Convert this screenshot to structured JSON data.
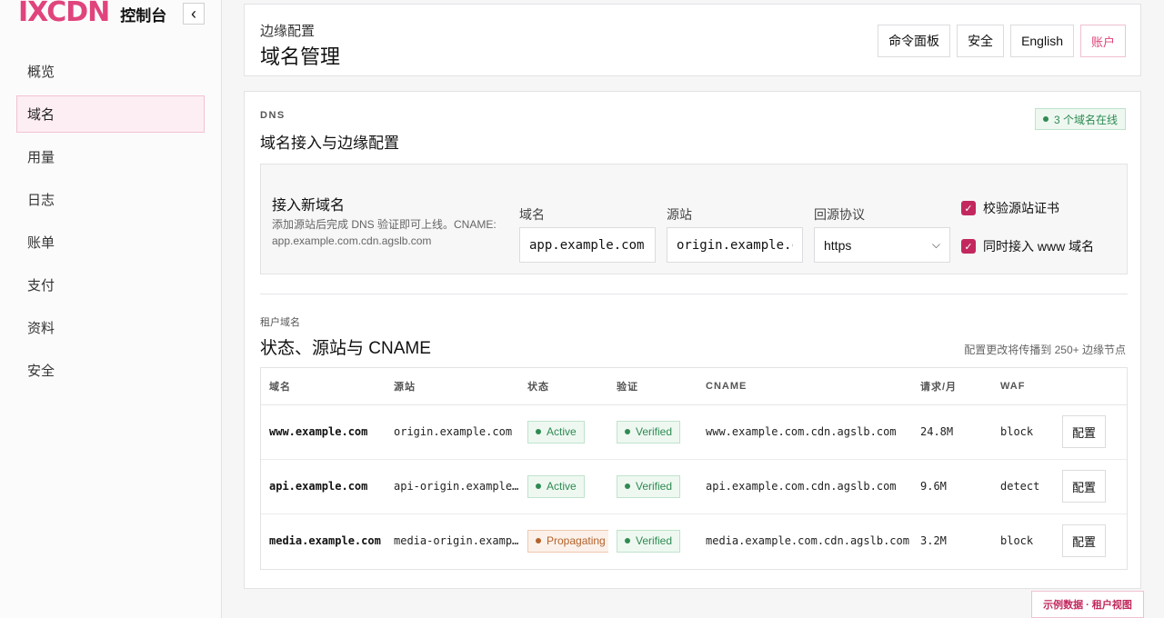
{
  "brand": {
    "logo": "IXCDN",
    "title": "控制台",
    "collapse_icon": "chevron-left-icon"
  },
  "nav": {
    "items": [
      {
        "label": "概览",
        "active": false
      },
      {
        "label": "域名",
        "active": true
      },
      {
        "label": "用量",
        "active": false
      },
      {
        "label": "日志",
        "active": false
      },
      {
        "label": "账单",
        "active": false
      },
      {
        "label": "支付",
        "active": false
      },
      {
        "label": "资料",
        "active": false
      },
      {
        "label": "安全",
        "active": false
      }
    ]
  },
  "header": {
    "eyebrow": "边缘配置",
    "title": "域名管理",
    "actions": {
      "command": "命令面板",
      "security": "安全",
      "language": "English",
      "account": "账户"
    }
  },
  "dns": {
    "label": "DNS",
    "title": "域名接入与边缘配置",
    "online_badge": "3 个域名在线"
  },
  "add_domain": {
    "title": "接入新域名",
    "description": "添加源站后完成 DNS 验证即可上线。CNAME: app.example.com.cdn.agslb.com",
    "domain_label": "域名",
    "domain_value": "app.example.com",
    "origin_label": "源站",
    "origin_value": "origin.example.com",
    "protocol_label": "回源协议",
    "protocol_value": "https",
    "verify_cert_label": "校验源站证书",
    "include_www_label": "同时接入 www 域名"
  },
  "tenant": {
    "label": "租户域名",
    "title": "状态、源站与 CNAME",
    "propagate_note": "配置更改将传播到 250+ 边缘节点"
  },
  "table": {
    "headers": {
      "domain": "域名",
      "origin": "源站",
      "status": "状态",
      "verify": "验证",
      "cname": "CNAME",
      "requests": "请求/月",
      "waf": "WAF"
    },
    "rows": [
      {
        "domain": "www.example.com",
        "origin": "origin.example.com",
        "status": "Active",
        "verify": "Verified",
        "cname": "www.example.com.cdn.agslb.com",
        "requests": "24.8M",
        "waf": "block",
        "action": "配置"
      },
      {
        "domain": "api.example.com",
        "origin": "api-origin.example.com",
        "status": "Active",
        "verify": "Verified",
        "cname": "api.example.com.cdn.agslb.com",
        "requests": "9.6M",
        "waf": "detect",
        "action": "配置"
      },
      {
        "domain": "media.example.com",
        "origin": "media-origin.example.com",
        "status": "Propagating",
        "verify": "Verified",
        "cname": "media.example.com.cdn.agslb.com",
        "requests": "3.2M",
        "waf": "block",
        "action": "配置"
      }
    ]
  },
  "footer_note": "示例数据 · 租户视图",
  "colors": {
    "accent": "#e0447c",
    "success": "#2f8a52",
    "warning": "#b4622a"
  }
}
